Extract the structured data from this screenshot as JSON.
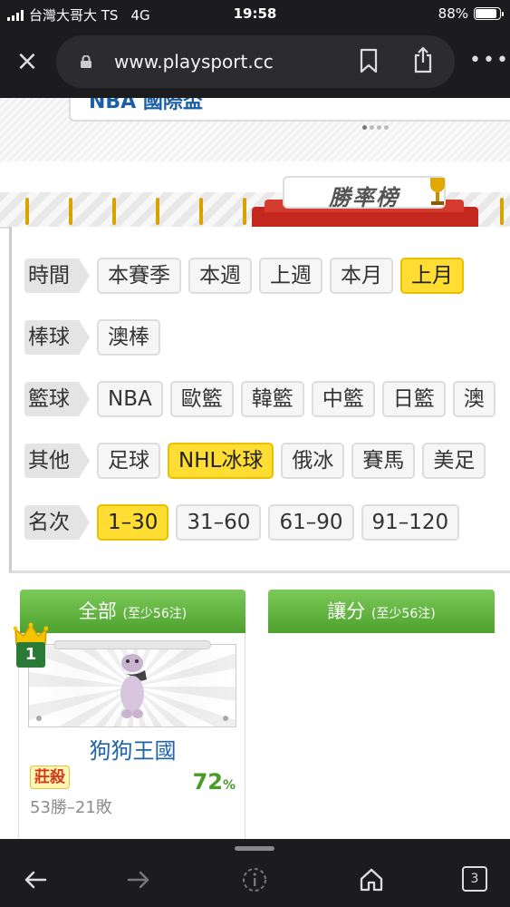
{
  "status_bar": {
    "carrier": "台灣大哥大 TS",
    "network": "4G",
    "time": "19:58",
    "battery": "88%",
    "battery_level": 0.88
  },
  "browser": {
    "url": "www.playsport.cc",
    "tab_count": "3"
  },
  "news_headline": "NBA 國際盃",
  "banner": {
    "title": "勝率榜"
  },
  "filters": {
    "time": {
      "label": "時間",
      "options": [
        "本賽季",
        "本週",
        "上週",
        "本月",
        "上月"
      ],
      "selected": "上月"
    },
    "baseball": {
      "label": "棒球",
      "options": [
        "澳棒"
      ]
    },
    "basketball": {
      "label": "籃球",
      "options": [
        "NBA",
        "歐籃",
        "韓籃",
        "中籃",
        "日籃",
        "澳"
      ]
    },
    "other": {
      "label": "其他",
      "options": [
        "足球",
        "NHL冰球",
        "俄冰",
        "賽馬",
        "美足"
      ],
      "selected": "NHL冰球"
    },
    "rank": {
      "label": "名次",
      "options": [
        "1–30",
        "31–60",
        "61–90",
        "91–120"
      ],
      "selected": "1–30"
    }
  },
  "tabs": [
    {
      "label": "全部",
      "note": "(至少56注)"
    },
    {
      "label": "讓分",
      "note": "(至少56注)"
    }
  ],
  "ranking": [
    {
      "rank": "1",
      "name": "狗狗王國",
      "badge": "莊殺",
      "win_rate": "72",
      "win_rate_unit": "%",
      "record": "53勝–21敗"
    }
  ],
  "colors": {
    "accent_yellow": "#ffdd33",
    "tab_green": "#4ea22d",
    "name_blue": "#1e63a8",
    "rate_green": "#4a9a28"
  }
}
